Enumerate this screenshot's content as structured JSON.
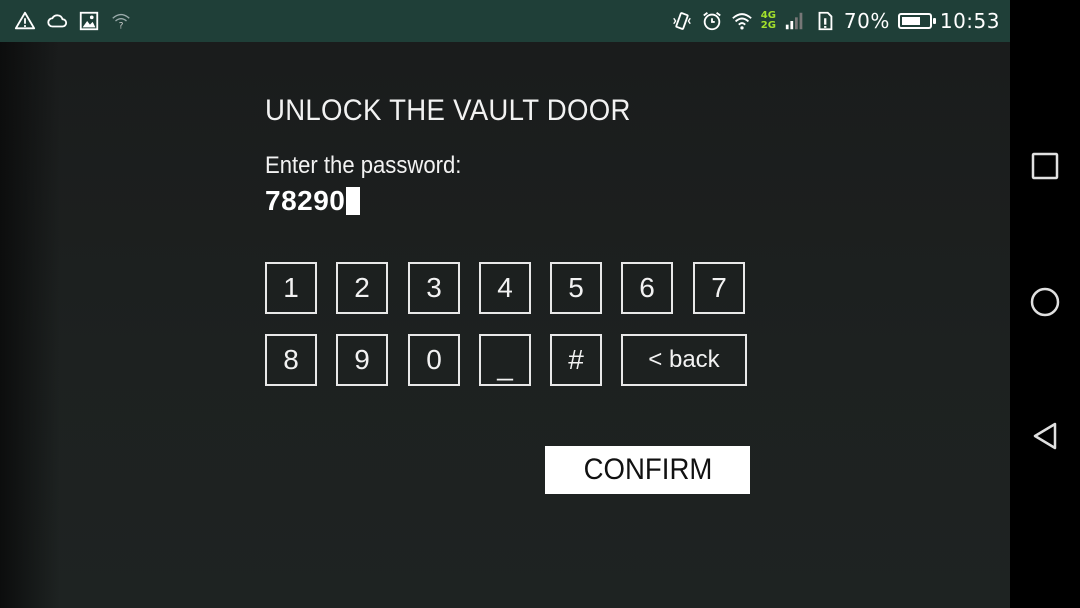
{
  "status_bar": {
    "left_icons": [
      "warning-icon",
      "cloud-icon",
      "image-icon",
      "wifi-question-icon"
    ],
    "right_icons": [
      "vibrate-icon",
      "alarm-icon",
      "wifi-icon",
      "signal-icon",
      "sim-icon"
    ],
    "network_top": "4G",
    "network_bottom": "2G",
    "battery_percent": "70%",
    "battery_level": 0.7,
    "time": "10:53",
    "background_color": "#1f3f38"
  },
  "vault": {
    "title": "UNLOCK THE VAULT DOOR",
    "prompt": "Enter the password:",
    "password_value": "78290"
  },
  "keypad": {
    "row1": [
      "1",
      "2",
      "3",
      "4",
      "5",
      "6",
      "7"
    ],
    "row2": [
      "8",
      "9",
      "0",
      "_",
      "#"
    ],
    "back_label": "< back"
  },
  "confirm_label": "CONFIRM",
  "nav": {
    "recents_icon": "square-recents-icon",
    "home_icon": "circle-home-icon",
    "back_icon": "triangle-back-icon"
  }
}
